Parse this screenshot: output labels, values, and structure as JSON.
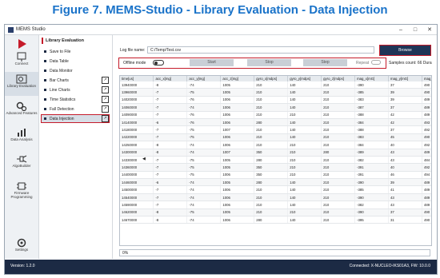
{
  "figure_title": "Figure 7. MEMS-Studio - Library Evaluation - Data Injection",
  "window": {
    "title": "MEMS Studio",
    "minimize": "–",
    "maximize": "□",
    "close": "✕"
  },
  "leftnav": [
    {
      "label": "Connect",
      "icon": "plug-icon"
    },
    {
      "label": "Library Evaluation",
      "icon": "library-evaluation-icon"
    },
    {
      "label": "Advanced Features",
      "icon": "gears-icon"
    },
    {
      "label": "Data Analysis",
      "icon": "chart-icon"
    },
    {
      "label": "AlgoBuilder",
      "icon": "algobuilder-icon"
    },
    {
      "label": "Firmware Programming",
      "icon": "chip-icon"
    },
    {
      "label": "Settings",
      "icon": "settings-icon"
    }
  ],
  "subnav": {
    "header": "Library Evaluation",
    "items": [
      {
        "label": "Save to File",
        "external": false
      },
      {
        "label": "Data Table",
        "external": false
      },
      {
        "label": "Data Monitor",
        "external": false
      },
      {
        "label": "Bar Charts",
        "external": true
      },
      {
        "label": "Line Charts",
        "external": true
      },
      {
        "label": "Time Statistics",
        "external": true
      },
      {
        "label": "Fall Detection",
        "external": true
      },
      {
        "label": "Data Injection",
        "external": true
      }
    ],
    "collapse_glyph": "◀"
  },
  "main": {
    "log_label": "Log file name:",
    "log_value": "C:/Temp/Test.csv",
    "browse_label": "Browse",
    "offline_label": "Offline mode",
    "start_label": "Start",
    "stop_label": "Stop",
    "step_label": "Step",
    "repeat_label": "Repeat",
    "samples_label": "Samples count:",
    "samples_value": "66",
    "duration_label": "Dura",
    "progress_text": "0%"
  },
  "table": {
    "headers": [
      "time[us]",
      "acc_x[mg]",
      "acc_y[mg]",
      "acc_z[mg]",
      "gyro_x[mdps]",
      "gyro_y[mdps]",
      "gyro_z[mdps]",
      "mag_x[mG]",
      "mag_y[mG]",
      "mag_z[mG]"
    ],
    "rows": [
      [
        "13940000",
        "-8",
        "-74",
        "1005",
        "210",
        "140",
        "210",
        "-390",
        "37",
        "490"
      ],
      [
        "13960000",
        "-7",
        "-75",
        "1005",
        "210",
        "140",
        "210",
        "-385",
        "39",
        "490"
      ],
      [
        "14020000",
        "-7",
        "-76",
        "1006",
        "210",
        "140",
        "210",
        "-383",
        "39",
        "489"
      ],
      [
        "14060000",
        "-7",
        "-74",
        "1006",
        "210",
        "140",
        "210",
        "-387",
        "37",
        "489"
      ],
      [
        "14090000",
        "-7",
        "-76",
        "1006",
        "210",
        "210",
        "210",
        "-388",
        "42",
        "489"
      ],
      [
        "14140000",
        "-6",
        "-76",
        "1006",
        "280",
        "140",
        "210",
        "-384",
        "42",
        "493"
      ],
      [
        "14180000",
        "-7",
        "-75",
        "1007",
        "210",
        "140",
        "210",
        "-388",
        "37",
        "492"
      ],
      [
        "14220000",
        "-7",
        "-75",
        "1006",
        "210",
        "140",
        "210",
        "-383",
        "45",
        "490"
      ],
      [
        "14250000",
        "-8",
        "-74",
        "1006",
        "210",
        "210",
        "210",
        "-384",
        "40",
        "492"
      ],
      [
        "14300000",
        "-8",
        "-74",
        "1007",
        "350",
        "210",
        "280",
        "-389",
        "43",
        "489"
      ],
      [
        "14330000",
        "-7",
        "-75",
        "1005",
        "280",
        "210",
        "210",
        "-382",
        "43",
        "484"
      ],
      [
        "14360000",
        "-7",
        "-75",
        "1005",
        "350",
        "210",
        "210",
        "-391",
        "40",
        "492"
      ],
      [
        "14400000",
        "-7",
        "-75",
        "1006",
        "350",
        "210",
        "210",
        "-391",
        "46",
        "494"
      ],
      [
        "14460000",
        "-6",
        "-74",
        "1005",
        "280",
        "140",
        "210",
        "-390",
        "39",
        "489"
      ],
      [
        "14500000",
        "-7",
        "-74",
        "1006",
        "210",
        "140",
        "210",
        "-385",
        "41",
        "489"
      ],
      [
        "14540000",
        "-7",
        "-74",
        "1006",
        "210",
        "140",
        "210",
        "-390",
        "43",
        "489"
      ],
      [
        "14590000",
        "-7",
        "-74",
        "1006",
        "210",
        "140",
        "210",
        "-382",
        "43",
        "489"
      ],
      [
        "14620000",
        "-8",
        "-75",
        "1005",
        "210",
        "210",
        "210",
        "-390",
        "37",
        "490"
      ],
      [
        "14670000",
        "-8",
        "-74",
        "1006",
        "280",
        "140",
        "210",
        "-395",
        "31",
        "490"
      ]
    ]
  },
  "status": {
    "version": "Version: 1.2.0",
    "connection": "Connected:  X-NUCLEO-IKS01A3,  FW: 10.0.0"
  },
  "colors": {
    "accent_red": "#c51b2a",
    "dark_navy": "#1c2a44",
    "title_blue": "#1a73c9"
  }
}
